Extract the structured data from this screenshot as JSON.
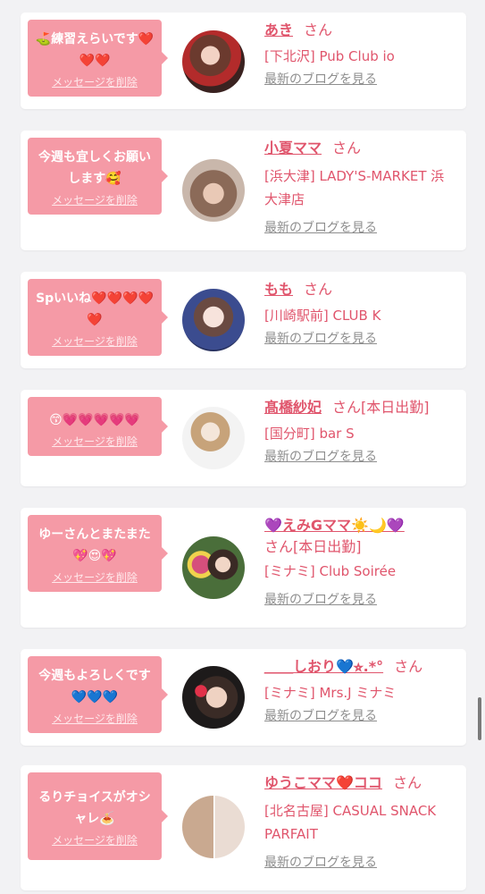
{
  "delete_label": "メッセージを削除",
  "blog_label": "最新のブログを見る",
  "entries": [
    {
      "message": "⛳練習えらいです❤️❤️❤️",
      "name": "あき",
      "suffix": "さん",
      "shop": "[下北沢] Pub Club io"
    },
    {
      "message": "今週も宜しくお願いします🥰",
      "name": "小夏ママ",
      "suffix": "さん",
      "shop": "[浜大津] LADY'S-MARKET 浜大津店"
    },
    {
      "message": "Spいいね❤️❤️❤️❤️❤️",
      "name": "もも",
      "suffix": "さん",
      "shop": "[川崎駅前] CLUB K"
    },
    {
      "message": "😙💗💗💗💗💗",
      "name": "髙橋紗妃",
      "suffix": "さん[本日出勤]",
      "shop": "[国分町] bar S"
    },
    {
      "message": "ゆーさんとまたまた💖😍💖",
      "name": "💜えみGママ☀️🌙💜",
      "suffix": "さん[本日出勤]",
      "shop": "[ミナミ] Club Soirée"
    },
    {
      "message": "今週もよろしくです💙💙💙",
      "name": "＿＿しおり💙⭐︎.*°",
      "suffix": "さん",
      "shop": "[ミナミ] Mrs.J ミナミ"
    },
    {
      "message": "るりチョイスがオシャレ🍝",
      "name": "ゆうこママ❤️ココ",
      "suffix": "さん",
      "shop": "[北名古屋] CASUAL SNACK PARFAIT"
    }
  ],
  "colors": {
    "background": "#f2f2f4",
    "bubble": "#f59aa6",
    "name": "#e0556c",
    "blog_link": "#8e8e8e"
  }
}
